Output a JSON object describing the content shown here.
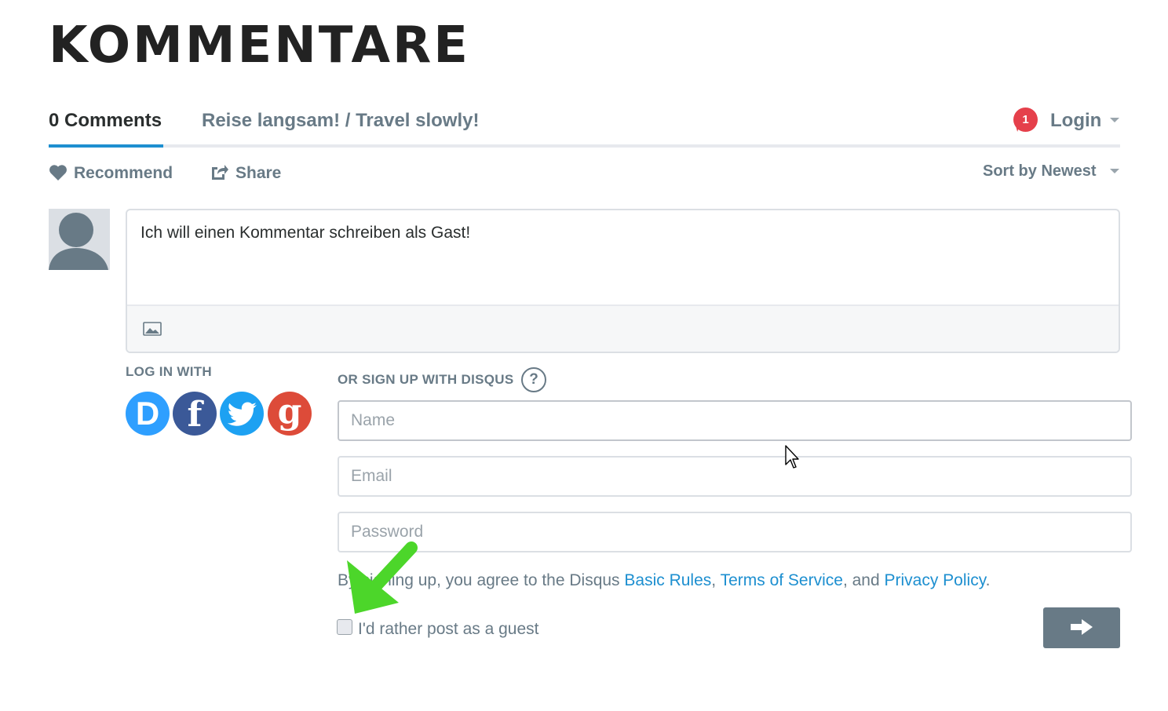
{
  "page": {
    "title": "KOMMENTARE"
  },
  "nav": {
    "comments_tab": "0 Comments",
    "community_tab": "Reise langsam! / Travel slowly!",
    "notification_count": "1",
    "login": "Login"
  },
  "actions": {
    "recommend": "Recommend",
    "share": "Share",
    "sort": "Sort by Newest"
  },
  "editor": {
    "text": "Ich will einen Kommentar schreiben als Gast!"
  },
  "auth": {
    "login_with_label": "LOG IN WITH",
    "signup_label": "OR SIGN UP WITH DISQUS",
    "help": "?",
    "providers": [
      {
        "name": "Disqus",
        "glyph": "D",
        "color": "#2e9fff"
      },
      {
        "name": "Facebook",
        "glyph": "f",
        "color": "#3b5998"
      },
      {
        "name": "Twitter",
        "glyph": "twitter-bird",
        "color": "#1da1f2"
      },
      {
        "name": "Google",
        "glyph": "g",
        "color": "#dd4b39"
      }
    ],
    "name_placeholder": "Name",
    "email_placeholder": "Email",
    "password_placeholder": "Password",
    "terms_prefix": "By signing up, you agree to the Disqus ",
    "terms_basic_rules": "Basic Rules",
    "terms_sep1": ", ",
    "terms_tos": "Terms of Service",
    "terms_sep2": ", and ",
    "terms_privacy": "Privacy Policy",
    "terms_suffix": ".",
    "guest_label": "I'd rather post as a guest",
    "guest_checked": false
  },
  "colors": {
    "accent": "#1d8fd0",
    "muted": "#687a86",
    "badge": "#e5404b",
    "annotation_arrow": "#4cd62a"
  }
}
